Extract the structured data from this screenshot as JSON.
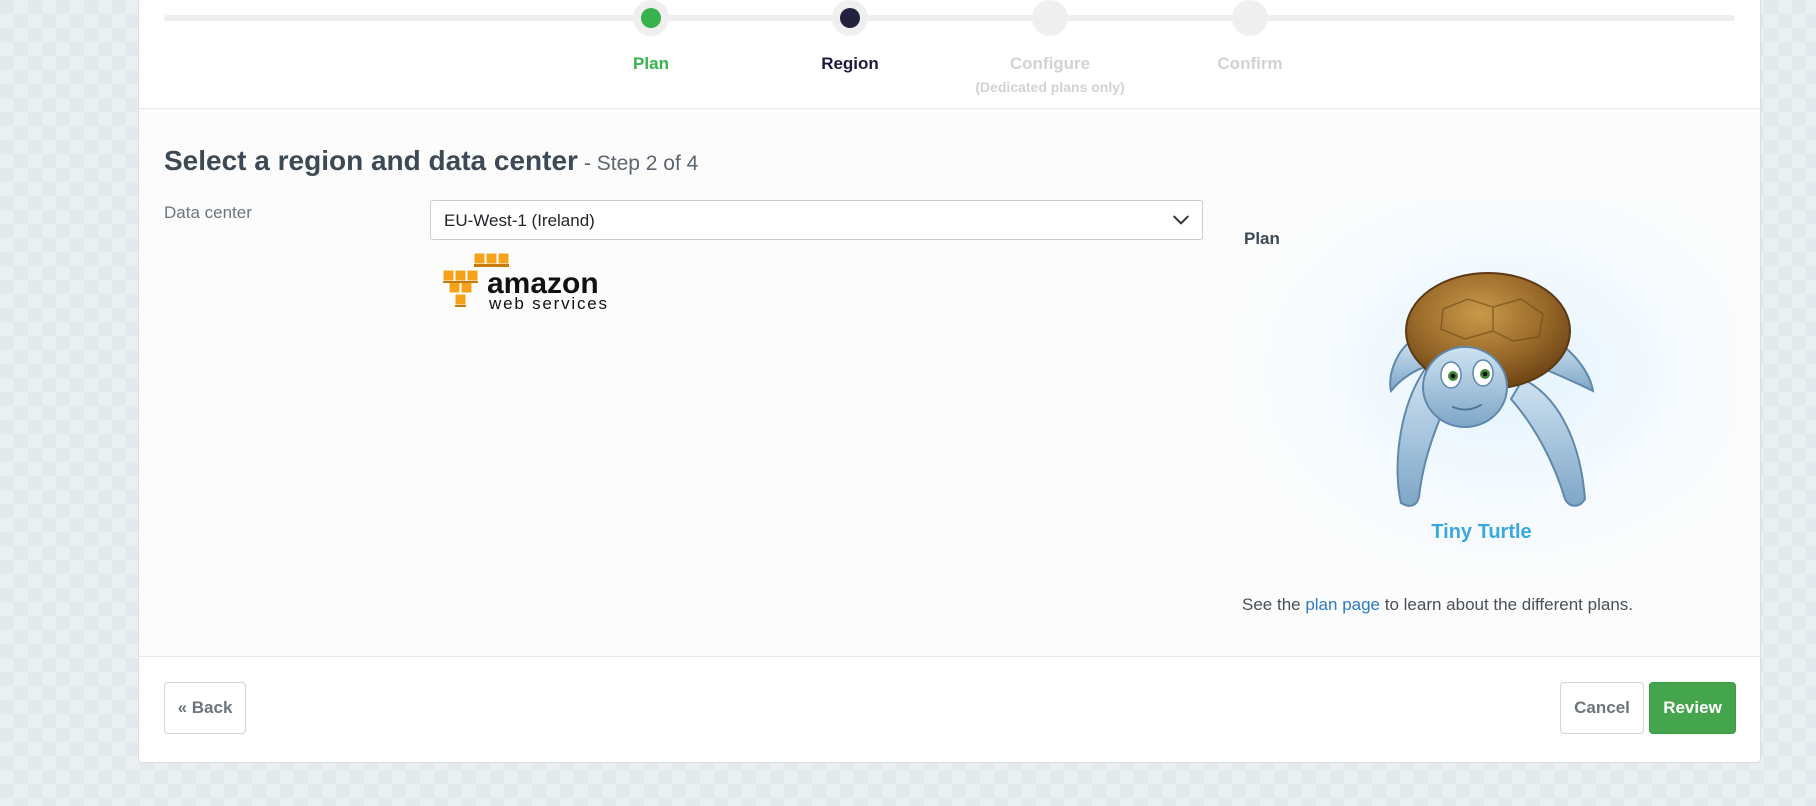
{
  "stepper": {
    "steps": [
      {
        "label": "Plan",
        "sublabel": "",
        "state": "done"
      },
      {
        "label": "Region",
        "sublabel": "",
        "state": "active"
      },
      {
        "label": "Configure",
        "sublabel": "(Dedicated plans only)",
        "state": "pending"
      },
      {
        "label": "Confirm",
        "sublabel": "",
        "state": "pending"
      }
    ]
  },
  "page": {
    "title": "Select a region and data center",
    "step_note": "- Step 2 of 4"
  },
  "form": {
    "data_center_label": "Data center",
    "data_center_value": "EU-West-1 (Ireland)",
    "provider_logo": {
      "line1": "amazon",
      "line2": "web services"
    }
  },
  "plan_panel": {
    "label": "Plan",
    "plan_name": "Tiny Turtle",
    "note_prefix": "See the ",
    "note_link": "plan page",
    "note_suffix": " to learn about the different plans."
  },
  "footer": {
    "back_label": "« Back",
    "cancel_label": "Cancel",
    "review_label": "Review"
  },
  "colors": {
    "done": "#37b24d",
    "active": "#1c1b3a",
    "pending": "#cfd3d6",
    "accent_green": "#45a54c",
    "link_blue": "#2b7bc0",
    "plan_name_blue": "#3aa9de",
    "aws_orange": "#f7a21b"
  }
}
